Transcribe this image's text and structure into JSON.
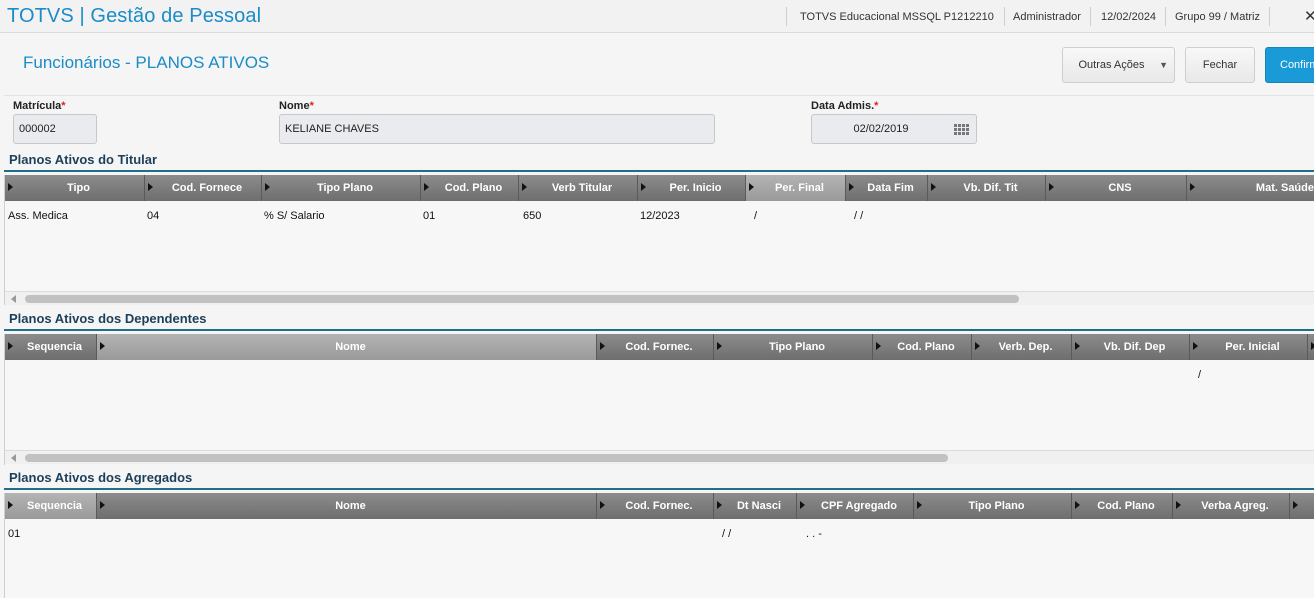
{
  "app": {
    "title": "TOTVS | Gestão de Pessoal",
    "environment": "TOTVS Educacional MSSQL P1212210",
    "user": "Administrador",
    "date": "12/02/2024",
    "group": "Grupo 99 / Matriz",
    "close_icon": "✕"
  },
  "header": {
    "title": "Funcionários - PLANOS ATIVOS",
    "actions": {
      "other": "Outras Ações",
      "close": "Fechar",
      "confirm": "Confirmar"
    }
  },
  "form": {
    "matricula": {
      "label": "Matrícula",
      "value": "000002"
    },
    "nome": {
      "label": "Nome",
      "value": "KELIANE CHAVES"
    },
    "data_admis": {
      "label": "Data Admis.",
      "value": "02/02/2019"
    }
  },
  "titular": {
    "title": "Planos Ativos do Titular",
    "columns": [
      "Tipo",
      "Cod. Fornece",
      "Tipo Plano",
      "Cod. Plano",
      "Verb Titular",
      "Per. Inicio",
      "Per. Final",
      "Data Fim",
      "Vb. Dif. Tit",
      "CNS",
      "Mat. Saúde"
    ],
    "rows": [
      [
        "Ass. Medica",
        "04",
        "% S/ Salario",
        "01",
        "650",
        "12/2023",
        "/",
        "/ /",
        "",
        "",
        ""
      ]
    ]
  },
  "dependentes": {
    "title": "Planos Ativos dos Dependentes",
    "columns": [
      "Sequencia",
      "Nome",
      "Cod. Fornec.",
      "Tipo Plano",
      "Cod. Plano",
      "Verb. Dep.",
      "Vb. Dif. Dep",
      "Per. Inicial"
    ],
    "rows": [
      [
        "",
        "",
        "",
        "",
        "",
        "",
        "",
        "/"
      ]
    ]
  },
  "agregados": {
    "title": "Planos Ativos dos Agregados",
    "columns": [
      "Sequencia",
      "Nome",
      "Cod. Fornec.",
      "Dt Nasci",
      "CPF Agregado",
      "Tipo Plano",
      "Cod. Plano",
      "Verba Agreg."
    ],
    "rows": [
      [
        "01",
        "",
        "",
        "/ /",
        ". . -",
        "",
        "",
        ""
      ]
    ]
  }
}
